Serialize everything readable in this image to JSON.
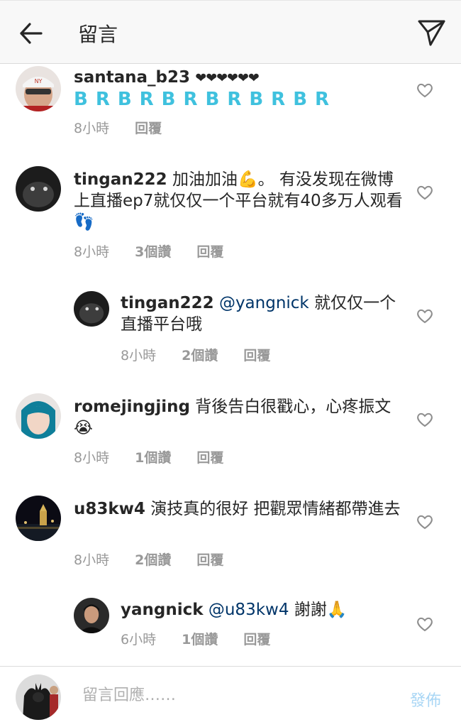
{
  "header": {
    "title": "留言",
    "back_icon": "arrow-left-icon",
    "send_icon": "paper-plane-icon"
  },
  "comments": [
    {
      "username": "santana_b23",
      "text": "❤❤❤❤❤❤",
      "extra": "BRBRBRBRBRBR",
      "time": "8小時",
      "likes": "",
      "reply_label": "回覆"
    },
    {
      "username": "tingan222",
      "text": "加油加油💪。 有没发现在微博上直播ep7就仅仅一个平台就有40多万人观看👣",
      "time": "8小時",
      "likes": "3個讚",
      "reply_label": "回覆"
    },
    {
      "username": "tingan222",
      "mention": "@yangnick",
      "text": "就仅仅一个直播平台哦",
      "time": "8小時",
      "likes": "2個讚",
      "reply_label": "回覆"
    },
    {
      "username": "romejingjing",
      "text": "背後告白很戳心，心疼振文😭",
      "time": "8小時",
      "likes": "1個讚",
      "reply_label": "回覆"
    },
    {
      "username": "u83kw4",
      "text": "演技真的很好 把觀眾情緒都帶進去",
      "time": "8小時",
      "likes": "2個讚",
      "reply_label": "回覆"
    },
    {
      "username": "yangnick",
      "mention": "@u83kw4",
      "text": "謝謝🙏",
      "time": "6小時",
      "likes": "1個讚",
      "reply_label": "回覆"
    }
  ],
  "footer": {
    "placeholder": "留言回應……",
    "post_label": "發佈"
  },
  "colors": {
    "accent": "#3fc1de",
    "mention": "#003569",
    "meta": "#999999",
    "post_disabled": "#a8d6f5"
  }
}
